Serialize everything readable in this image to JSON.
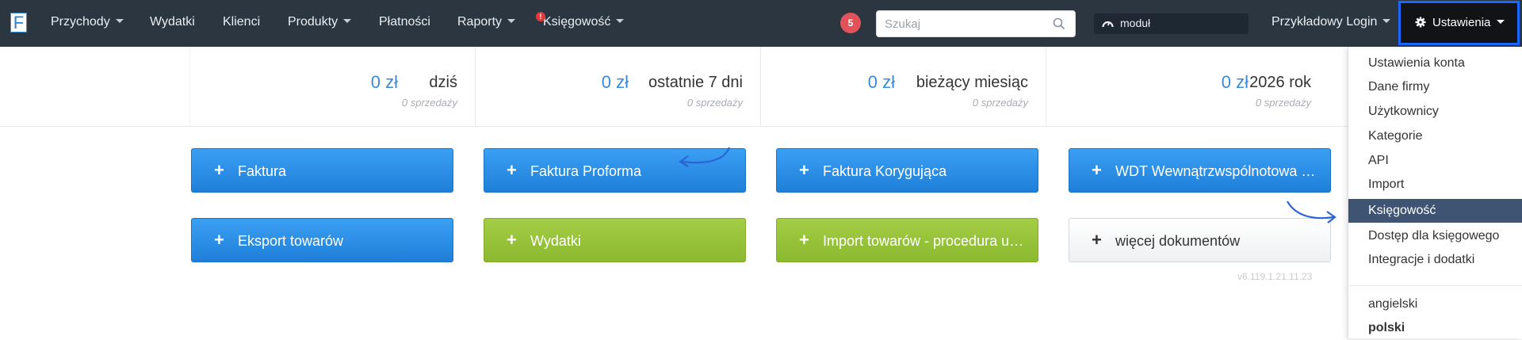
{
  "navbar": {
    "logo": "F",
    "items": [
      {
        "label": "Przychody",
        "dropdown": true
      },
      {
        "label": "Wydatki",
        "dropdown": false
      },
      {
        "label": "Klienci",
        "dropdown": false
      },
      {
        "label": "Produkty",
        "dropdown": true
      },
      {
        "label": "Płatności",
        "dropdown": false
      },
      {
        "label": "Raporty",
        "dropdown": true
      },
      {
        "label": "Księgowość",
        "dropdown": true,
        "alert": "!"
      }
    ],
    "notification_count": "5",
    "search_placeholder": "Szukaj",
    "module_label": "moduł",
    "user_label": "Przykładowy Login",
    "settings_label": "Ustawienia"
  },
  "stats": [
    {
      "amount": "0 zł",
      "label": "dziś",
      "sub": "0 sprzedaży"
    },
    {
      "amount": "0 zł",
      "label": "ostatnie 7 dni",
      "sub": "0 sprzedaży"
    },
    {
      "amount": "0 zł",
      "label": "bieżący miesiąc",
      "sub": "0 sprzedaży"
    },
    {
      "amount": "0 zł",
      "label": "2026 rok",
      "sub": "0 sprzedaży"
    }
  ],
  "buttons": [
    {
      "label": "Faktura",
      "style": "blue"
    },
    {
      "label": "Faktura Proforma",
      "style": "blue"
    },
    {
      "label": "Faktura Korygująca",
      "style": "blue"
    },
    {
      "label": "WDT Wewnątrzwspólnotowa …",
      "style": "blue"
    },
    {
      "label": "Eksport towarów",
      "style": "blue"
    },
    {
      "label": "Wydatki",
      "style": "green"
    },
    {
      "label": "Import towarów - procedura u…",
      "style": "green"
    },
    {
      "label": "więcej dokumentów",
      "style": "grey"
    }
  ],
  "version": "v6.119.1.21.11.23",
  "settings_menu": {
    "items": [
      "Ustawienia konta",
      "Dane firmy",
      "Użytkownicy",
      "Kategorie",
      "API",
      "Import",
      "Księgowość",
      "Dostęp dla księgowego",
      "Integracje i dodatki"
    ],
    "active_index": 6,
    "languages": [
      "angielski",
      "polski"
    ],
    "selected_language": "polski"
  },
  "colors": {
    "navbar": "#2b3641",
    "accent_blue": "#1f7fd8",
    "accent_green": "#8bb92f",
    "active_menu": "#3e5472",
    "highlight_border": "#1a66ff"
  }
}
